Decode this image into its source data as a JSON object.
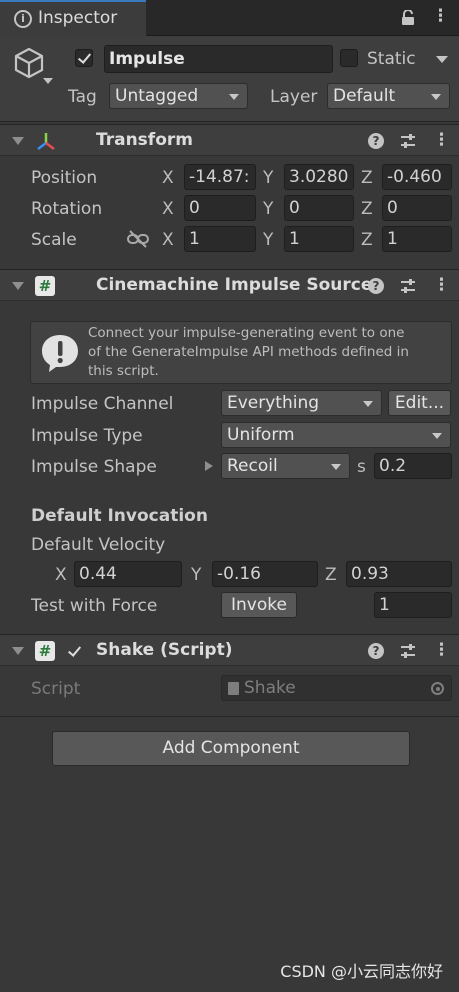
{
  "tab": {
    "title": "Inspector"
  },
  "object": {
    "name": "Impulse",
    "static_label": "Static",
    "tag_label": "Tag",
    "tag_value": "Untagged",
    "layer_label": "Layer",
    "layer_value": "Default"
  },
  "transform": {
    "title": "Transform",
    "position_label": "Position",
    "rotation_label": "Rotation",
    "scale_label": "Scale",
    "axis_x": "X",
    "axis_y": "Y",
    "axis_z": "Z",
    "position": {
      "x": "-14.87:",
      "y": "3.0280",
      "z": "-0.460"
    },
    "rotation": {
      "x": "0",
      "y": "0",
      "z": "0"
    },
    "scale": {
      "x": "1",
      "y": "1",
      "z": "1"
    }
  },
  "impulse_source": {
    "title": "Cinemachine Impulse Source",
    "info_line1": "Connect your impulse-generating event to one",
    "info_line2": "of the GenerateImpulse API methods defined in",
    "info_line3": "this script.",
    "channel_label": "Impulse Channel",
    "channel_value": "Everything",
    "edit_label": "Edit...",
    "type_label": "Impulse Type",
    "type_value": "Uniform",
    "shape_label": "Impulse Shape",
    "shape_value": "Recoil",
    "s_label": "s",
    "s_value": "0.2",
    "default_invocation": "Default Invocation",
    "default_velocity": "Default Velocity",
    "velocity": {
      "x": "0.44",
      "y": "-0.16",
      "z": "0.93"
    },
    "test_force_label": "Test with Force",
    "invoke_label": "Invoke",
    "force_value": "1"
  },
  "shake": {
    "title": "Shake (Script)",
    "script_label": "Script",
    "script_value": "Shake"
  },
  "add_component": "Add Component",
  "watermark": "CSDN @小云同志你好",
  "colors": {
    "background": "#383838",
    "header": "#3e3e3e",
    "field": "#2a2a2a",
    "script_green": "#2b7a3b"
  }
}
